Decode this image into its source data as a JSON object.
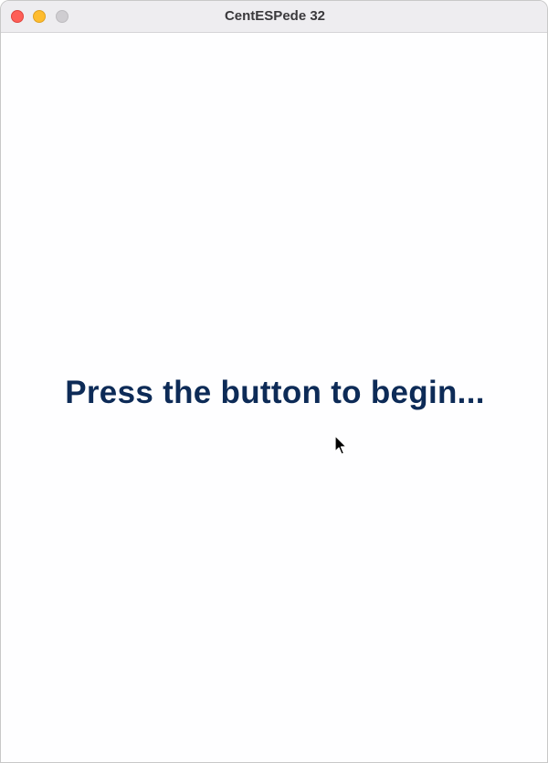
{
  "window": {
    "title": "CentESPede 32"
  },
  "controls": {
    "close": "close-button",
    "minimize": "minimize-button",
    "zoom": "zoom-button"
  },
  "content": {
    "prompt": "Press the button to begin..."
  },
  "colors": {
    "prompt_text": "#0d2b57",
    "titlebar": "#eeedf0",
    "close": "#fe5f57",
    "minimize": "#febc2e",
    "zoom": "#cfcdd1"
  }
}
